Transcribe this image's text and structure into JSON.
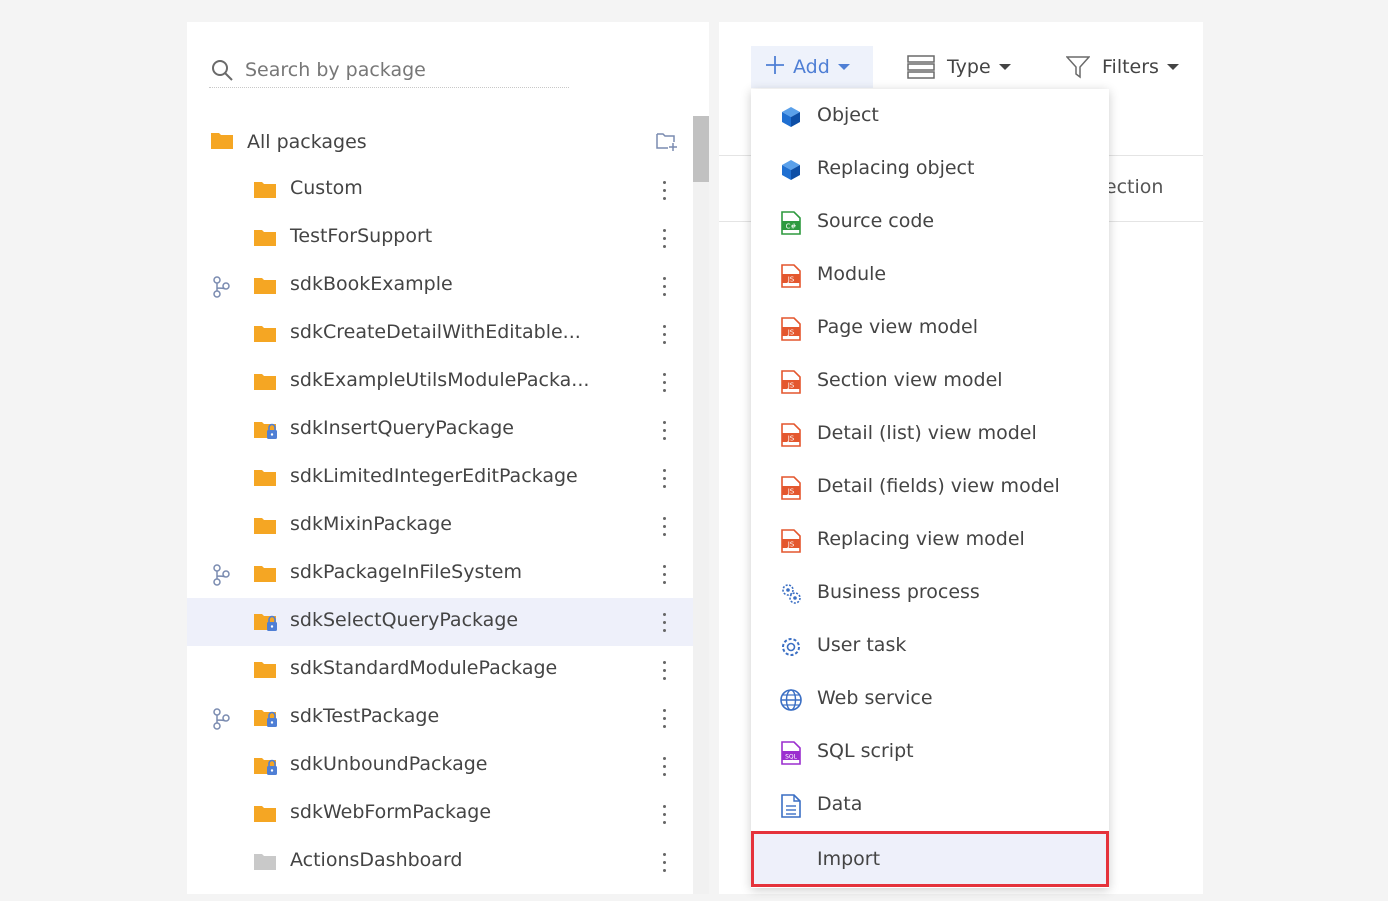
{
  "search": {
    "placeholder": "Search by package",
    "icon": "search-icon"
  },
  "tree": {
    "root_label": "All packages",
    "items": [
      {
        "label": "Custom",
        "folder": "orange",
        "git": false,
        "locked": false
      },
      {
        "label": "TestForSupport",
        "folder": "orange",
        "git": false,
        "locked": false
      },
      {
        "label": "sdkBookExample",
        "folder": "orange",
        "git": true,
        "locked": false
      },
      {
        "label": "sdkCreateDetailWithEditable...",
        "folder": "orange",
        "git": false,
        "locked": false
      },
      {
        "label": "sdkExampleUtilsModulePacka...",
        "folder": "orange",
        "git": false,
        "locked": false
      },
      {
        "label": "sdkInsertQueryPackage",
        "folder": "orange",
        "git": false,
        "locked": true
      },
      {
        "label": "sdkLimitedIntegerEditPackage",
        "folder": "orange",
        "git": false,
        "locked": false
      },
      {
        "label": "sdkMixinPackage",
        "folder": "orange",
        "git": false,
        "locked": false
      },
      {
        "label": "sdkPackageInFileSystem",
        "folder": "orange",
        "git": true,
        "locked": false
      },
      {
        "label": "sdkSelectQueryPackage",
        "folder": "orange",
        "git": false,
        "locked": true,
        "selected": true
      },
      {
        "label": "sdkStandardModulePackage",
        "folder": "orange",
        "git": false,
        "locked": false
      },
      {
        "label": "sdkTestPackage",
        "folder": "orange",
        "git": true,
        "locked": true
      },
      {
        "label": "sdkUnboundPackage",
        "folder": "orange",
        "git": false,
        "locked": true
      },
      {
        "label": "sdkWebFormPackage",
        "folder": "orange",
        "git": false,
        "locked": false
      },
      {
        "label": "ActionsDashboard",
        "folder": "gray",
        "git": false,
        "locked": false
      }
    ]
  },
  "toolbar": {
    "add_label": "Add",
    "type_label": "Type",
    "filters_label": "Filters"
  },
  "section_text": "section",
  "menu": {
    "items": [
      {
        "label": "Object",
        "icon": "cube-icon"
      },
      {
        "label": "Replacing object",
        "icon": "cube-icon"
      },
      {
        "label": "Source code",
        "icon": "csharp-file-icon"
      },
      {
        "label": "Module",
        "icon": "js-file-icon"
      },
      {
        "label": "Page view model",
        "icon": "js-file-icon"
      },
      {
        "label": "Section view model",
        "icon": "js-file-icon"
      },
      {
        "label": "Detail (list) view model",
        "icon": "js-file-icon"
      },
      {
        "label": "Detail (fields) view model",
        "icon": "js-file-icon"
      },
      {
        "label": "Replacing view model",
        "icon": "js-file-icon"
      },
      {
        "label": "Business process",
        "icon": "process-icon"
      },
      {
        "label": "User task",
        "icon": "gear-icon"
      },
      {
        "label": "Web service",
        "icon": "globe-icon"
      },
      {
        "label": "SQL script",
        "icon": "sql-file-icon"
      },
      {
        "label": "Data",
        "icon": "document-icon"
      },
      {
        "label": "Import",
        "icon": "",
        "highlighted": true
      }
    ]
  },
  "colors": {
    "accent": "#4f7fd5",
    "folder": "#f5a623",
    "folder_gray": "#c9c9c9",
    "highlight_border": "#e5323b",
    "selected_bg": "#eef0fa"
  }
}
